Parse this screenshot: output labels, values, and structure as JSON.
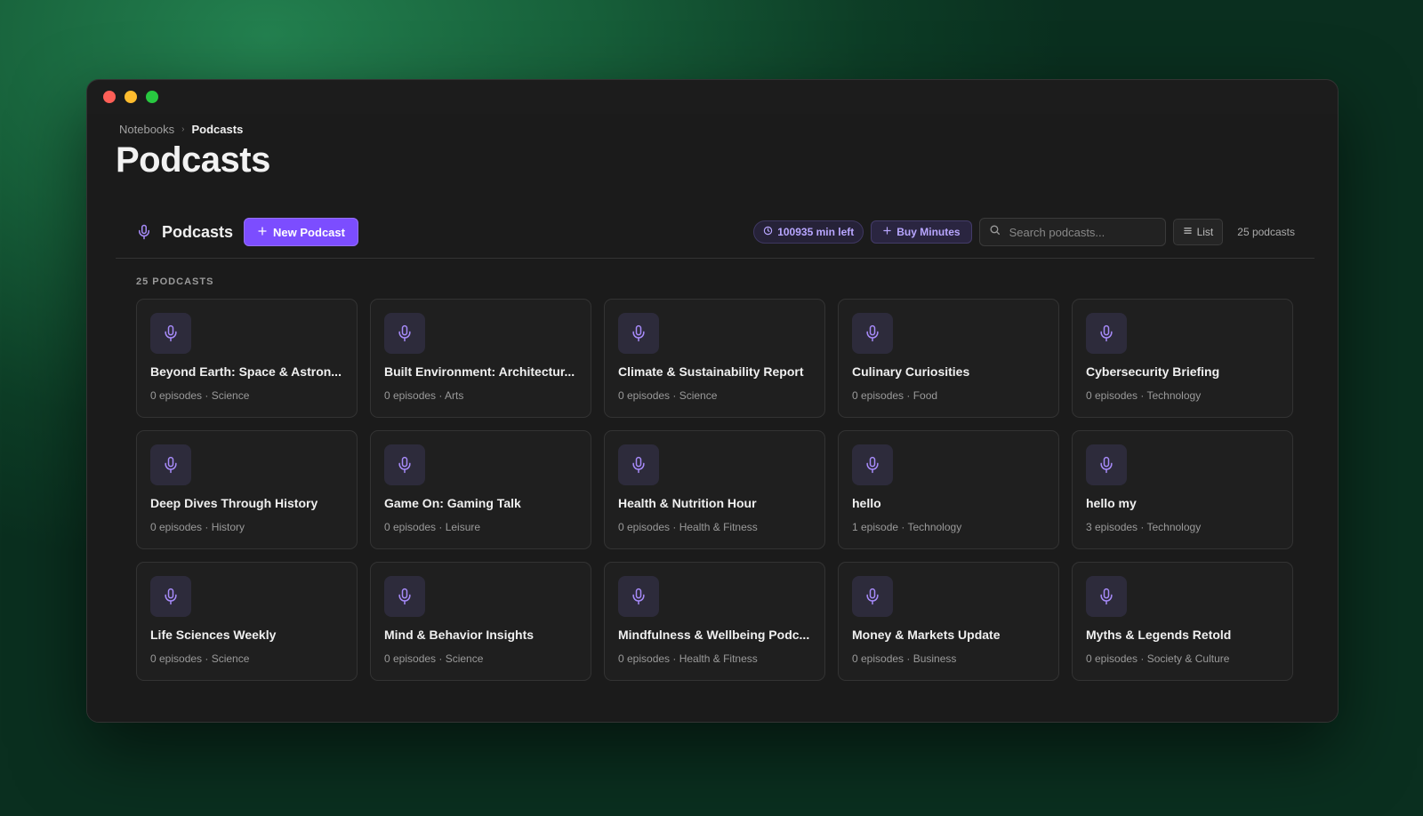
{
  "breadcrumb": {
    "parent": "Notebooks",
    "current": "Podcasts"
  },
  "page_title": "Podcasts",
  "toolbar": {
    "title": "Podcasts",
    "title_icon": "microphone-icon",
    "new_button_label": "New Podcast",
    "minutes_left": "100935 min left",
    "buy_minutes_label": "Buy Minutes",
    "search_placeholder": "Search podcasts...",
    "view_label": "List",
    "count_label": "25 podcasts"
  },
  "section_label": "25 PODCASTS",
  "colors": {
    "accent": "#7c4dff",
    "accent_text": "#b8a6ff",
    "icon": "#a78bfa"
  },
  "podcasts": [
    {
      "title": "Beyond Earth: Space & Astron...",
      "meta": "0 episodes · Science"
    },
    {
      "title": "Built Environment: Architectur...",
      "meta": "0 episodes · Arts"
    },
    {
      "title": "Climate & Sustainability Report",
      "meta": "0 episodes · Science"
    },
    {
      "title": "Culinary Curiosities",
      "meta": "0 episodes · Food"
    },
    {
      "title": "Cybersecurity Briefing",
      "meta": "0 episodes · Technology"
    },
    {
      "title": "Deep Dives Through History",
      "meta": "0 episodes · History"
    },
    {
      "title": "Game On: Gaming Talk",
      "meta": "0 episodes · Leisure"
    },
    {
      "title": "Health & Nutrition Hour",
      "meta": "0 episodes · Health & Fitness"
    },
    {
      "title": "hello",
      "meta": "1 episode · Technology"
    },
    {
      "title": "hello my",
      "meta": "3 episodes · Technology"
    },
    {
      "title": "Life Sciences Weekly",
      "meta": "0 episodes · Science"
    },
    {
      "title": "Mind & Behavior Insights",
      "meta": "0 episodes · Science"
    },
    {
      "title": "Mindfulness & Wellbeing Podc...",
      "meta": "0 episodes · Health & Fitness"
    },
    {
      "title": "Money & Markets Update",
      "meta": "0 episodes · Business"
    },
    {
      "title": "Myths & Legends Retold",
      "meta": "0 episodes · Society & Culture"
    }
  ]
}
